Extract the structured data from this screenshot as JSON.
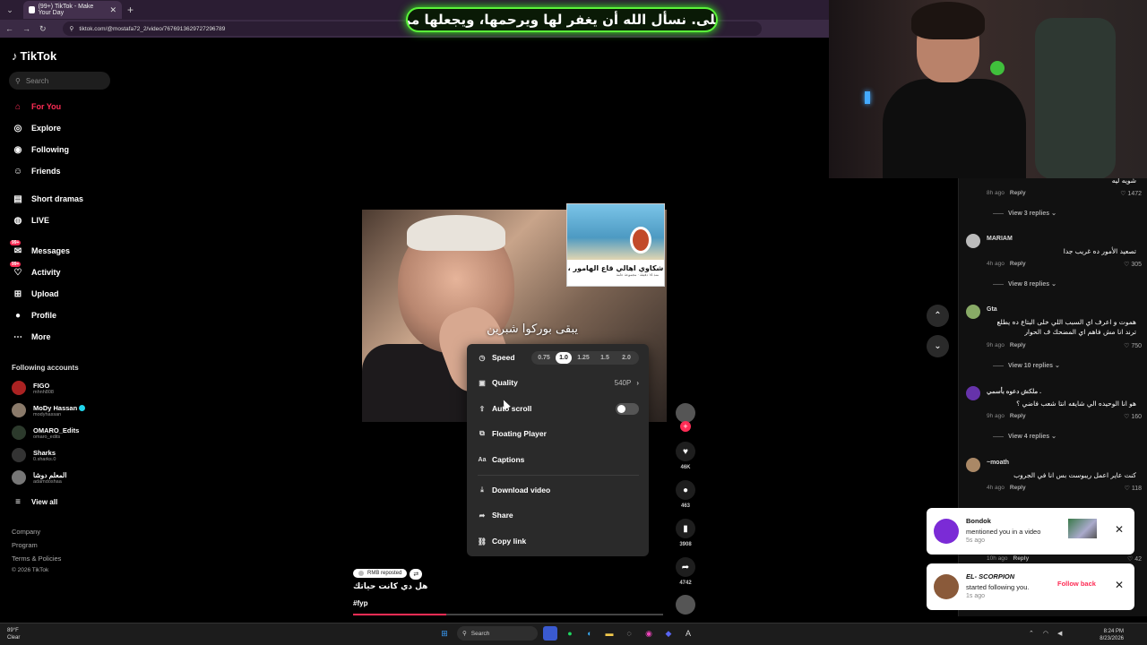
{
  "browser": {
    "tab_title": "(99+) TikTok - Make Your Day",
    "url": "tiktok.com/@mostafa72_2/video/7676913629727296789"
  },
  "banner_text": "على. نسأل الله أن يغفر لها ويرحمها، ويجعلها من",
  "sidebar": {
    "logo": "TikTok",
    "search_placeholder": "Search",
    "nav": [
      {
        "label": "For You",
        "icon": "home-icon"
      },
      {
        "label": "Explore",
        "icon": "compass-icon"
      },
      {
        "label": "Following",
        "icon": "following-icon"
      },
      {
        "label": "Friends",
        "icon": "friends-icon"
      },
      {
        "label": "Short dramas",
        "icon": "drama-icon"
      },
      {
        "label": "LIVE",
        "icon": "live-icon"
      },
      {
        "label": "Messages",
        "icon": "message-icon",
        "badge": "99+"
      },
      {
        "label": "Activity",
        "icon": "activity-icon",
        "badge": "99+"
      },
      {
        "label": "Upload",
        "icon": "upload-icon"
      },
      {
        "label": "Profile",
        "icon": "profile-icon"
      },
      {
        "label": "More",
        "icon": "more-icon"
      }
    ],
    "following_title": "Following accounts",
    "accounts": [
      {
        "name": "FIGO",
        "handle": "mhnh808"
      },
      {
        "name": "MoDy Hassan",
        "handle": "modyhassan",
        "verified": true
      },
      {
        "name": "OMARO_Edits",
        "handle": "omaro_edits"
      },
      {
        "name": "Sharks",
        "handle": "0.sharks.0"
      },
      {
        "name": "المعلم دوشا",
        "handle": "adamdoshaa"
      }
    ],
    "view_all": "View all",
    "footer": [
      "Company",
      "Program",
      "Terms & Policies",
      "© 2026 TikTok"
    ]
  },
  "video": {
    "caption_overlay": "يبقى بوركوا شبرين",
    "inset_text": "شكاوي اهالي قاع الهامور ،",
    "inset_sub": "منذ ١٥ دقيقة · مجموعة عامة",
    "progress": 0.3
  },
  "menu": {
    "speed_label": "Speed",
    "speeds": [
      "0.75",
      "1.0",
      "1.25",
      "1.5",
      "2.0"
    ],
    "speed_selected": "1.0",
    "quality_label": "Quality",
    "quality_value": "540P",
    "autoscroll_label": "Auto scroll",
    "autoscroll_on": false,
    "floating_label": "Floating Player",
    "captions_label": "Captions",
    "download_label": "Download video",
    "share_label": "Share",
    "copy_label": "Copy link"
  },
  "actions": {
    "likes": "46K",
    "comments": "463",
    "saves": "3908",
    "shares": "4742"
  },
  "post": {
    "repost_label": "RMB reposted",
    "title": "هل دي كانت حياتك",
    "hashtag": "#fyp"
  },
  "comments": [
    {
      "user": "",
      "text": "شويه ليه",
      "time": "8h ago",
      "reply": "Reply",
      "likes": "1472",
      "replies": "View 3 replies"
    },
    {
      "user": "MARIAM",
      "text": "تصعيد الأمور ده غريب جدا",
      "time": "4h ago",
      "reply": "Reply",
      "likes": "305",
      "replies": "View 8 replies"
    },
    {
      "user": "Gta",
      "text": "هموت و اعرف اي السبب اللي خلى البتاع ده يطلع ترند انا مش فاهم اي المضحك ف الحوار",
      "time": "9h ago",
      "reply": "Reply",
      "likes": "750",
      "replies": "View 10 replies"
    },
    {
      "user": "ملكش دعوه بأسمي .",
      "text": "هو انا الوحيده الي شايفه انتا شعب فاضي ؟",
      "time": "9h ago",
      "reply": "Reply",
      "likes": "160",
      "replies": "View 4 replies"
    },
    {
      "user": "~moath",
      "text": "كنت عاير اعمل ريبوست بس انا في الجروب",
      "time": "4h ago",
      "reply": "Reply",
      "likes": "118",
      "replies": ""
    },
    {
      "user": "",
      "text": "",
      "time": "10h ago",
      "reply": "Reply",
      "likes": "42",
      "replies": ""
    }
  ],
  "notifications": [
    {
      "name": "Bondok",
      "message": "mentioned you in a video",
      "time": "5s ago"
    },
    {
      "name": "EL- SCORPION",
      "message": "started following you.",
      "time": "1s ago",
      "action": "Follow back"
    }
  ],
  "taskbar": {
    "weather_temp": "89°F",
    "weather_desc": "Clear",
    "search_label": "Search",
    "time": "8:24 PM",
    "date": "8/23/2026"
  }
}
